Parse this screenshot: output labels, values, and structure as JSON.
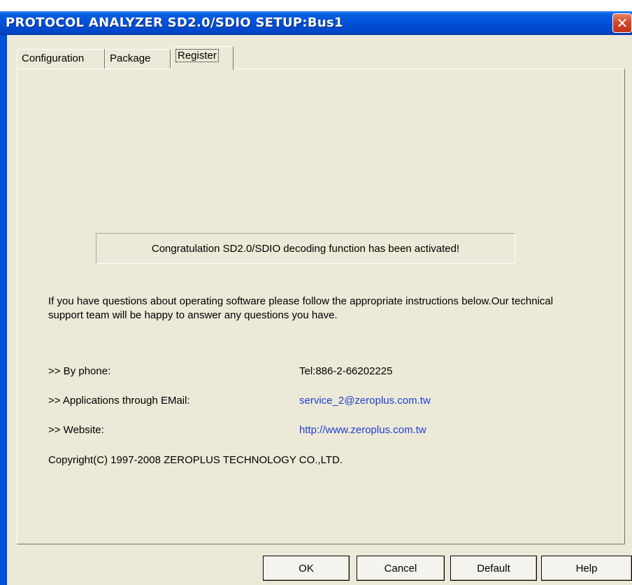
{
  "window": {
    "title": "PROTOCOL ANALYZER SD2.0/SDIO SETUP:Bus1",
    "close_label": "✕"
  },
  "tabs": [
    {
      "label": "Configuration",
      "active": false
    },
    {
      "label": "Package",
      "active": false
    },
    {
      "label": "Register",
      "active": true
    }
  ],
  "register": {
    "status_message": "Congratulation SD2.0/SDIO decoding function has been activated!",
    "intro": "If you have questions about operating software please follow the appropriate instructions below.Our technical support team will be happy to answer any questions you have.",
    "phone": {
      "label": ">> By phone:",
      "value": "Tel:886-2-66202225"
    },
    "email": {
      "label": ">> Applications through EMail:",
      "value": "service_2@zeroplus.com.tw"
    },
    "website": {
      "label": ">> Website:",
      "value": "http://www.zeroplus.com.tw"
    },
    "copyright": "Copyright(C) 1997-2008 ZEROPLUS TECHNOLOGY CO.,LTD."
  },
  "buttons": {
    "ok": "OK",
    "cancel": "Cancel",
    "default": "Default",
    "help": "Help"
  },
  "colors": {
    "titlebar": "#0050d8",
    "dialog_bg": "#ece9d8",
    "link": "#1f3fd2",
    "close_button": "#d6462a"
  }
}
